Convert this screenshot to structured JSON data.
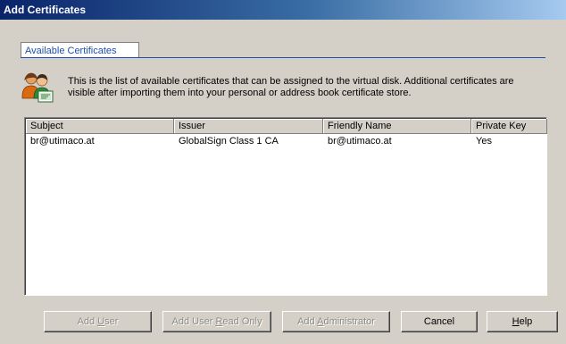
{
  "window": {
    "title": "Add Certificates"
  },
  "tab": {
    "label": "Available Certificates"
  },
  "description": {
    "line1": "This is the list of available certificates that can be assigned to the virtual disk. Additional certificates are",
    "line2": "visible after importing them into your personal or address book certificate store."
  },
  "icon": {
    "name": "users-certificate-icon"
  },
  "list": {
    "columns": [
      "Subject",
      "Issuer",
      "Friendly Name",
      "Private Key"
    ],
    "rows": [
      [
        "br@utimaco.at",
        "GlobalSign Class 1 CA",
        "br@utimaco.at",
        "Yes"
      ]
    ]
  },
  "buttons": {
    "add_user": {
      "pre": "Add ",
      "ul": "U",
      "post": "ser",
      "enabled": false
    },
    "add_user_read_only": {
      "pre": "Add User ",
      "ul": "R",
      "post": "ead Only",
      "enabled": false
    },
    "add_administrator": {
      "pre": "Add ",
      "ul": "A",
      "post": "dministrator",
      "enabled": false
    },
    "cancel": {
      "pre": "Cancel",
      "ul": "",
      "post": "",
      "enabled": true
    },
    "help": {
      "pre": "",
      "ul": "H",
      "post": "elp",
      "enabled": true
    }
  },
  "colors": {
    "title_bar_start": "#0a246a",
    "title_bar_end": "#a6caf0",
    "tab_text": "#1c4fa8",
    "dialog_bg": "#d4d0c8"
  }
}
